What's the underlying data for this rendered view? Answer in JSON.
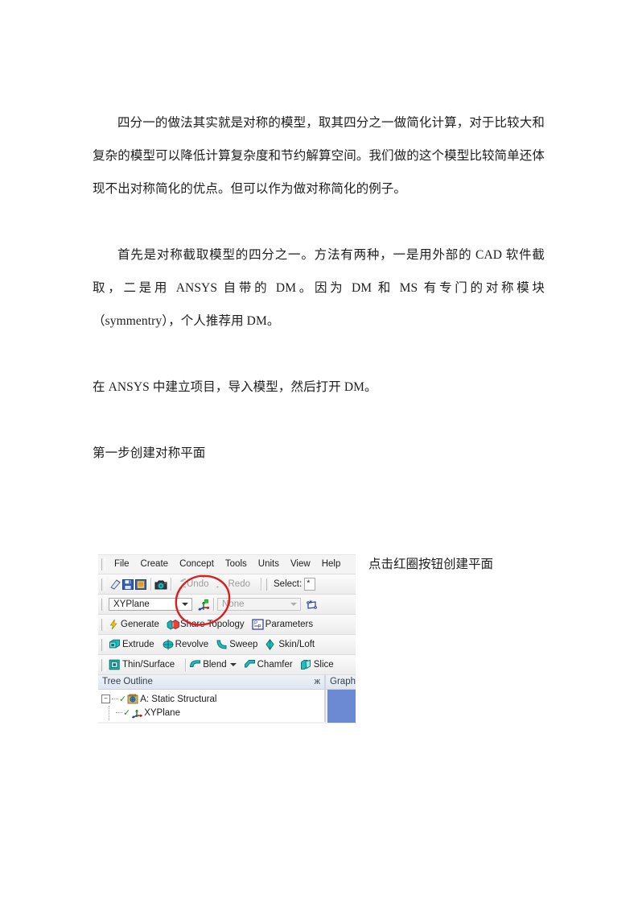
{
  "document": {
    "paragraphs": [
      "四分一的做法其实就是对称的模型，取其四分之一做简化计算，对于比较大和复杂的模型可以降低计算复杂度和节约解算空间。我们做的这个模型比较简单还体现不出对称简化的优点。但可以作为做对称简化的例子。",
      "首先是对称截取模型的四分之一。方法有两种，一是用外部的 CAD 软件截取，二是用 ANSYS 自带的 DM。因为 DM 和 MS 有专门的对称模块（symmentry），个人推荐用 DM。",
      "在 ANSYS 中建立项目，导入模型，然后打开 DM。",
      "第一步创建对称平面"
    ],
    "annotation": "点击红圈按钮创建平面"
  },
  "screenshot": {
    "menubar": [
      "File",
      "Create",
      "Concept",
      "Tools",
      "Units",
      "View",
      "Help"
    ],
    "toolbar_main": {
      "undo": "Undo",
      "redo": "Redo",
      "select_label": "Select:",
      "select_value": "*"
    },
    "toolbar_plane": {
      "plane_value": "XYPlane",
      "sketch_value": "None"
    },
    "toolbar_generate": [
      "Generate",
      "Share Topology",
      "Parameters"
    ],
    "toolbar_features": [
      "Extrude",
      "Revolve",
      "Sweep",
      "Skin/Loft"
    ],
    "toolbar_modify": [
      "Thin/Surface",
      "Blend",
      "Chamfer",
      "Slice"
    ],
    "tree": {
      "title": "Tree Outline",
      "pin": "ж",
      "root": "A: Static Structural",
      "child": "XYPlane",
      "expander": "−"
    },
    "graphics": {
      "title": "Graph"
    }
  },
  "colors": {
    "annotation_text": "#1d1d1d",
    "oval_red": "#e01b1b",
    "icon_teal": "#19a9a0",
    "icon_blue": "#2b5fc4",
    "viewport_blue": "#6c8ad4",
    "tree_green_check": "#12a012"
  }
}
